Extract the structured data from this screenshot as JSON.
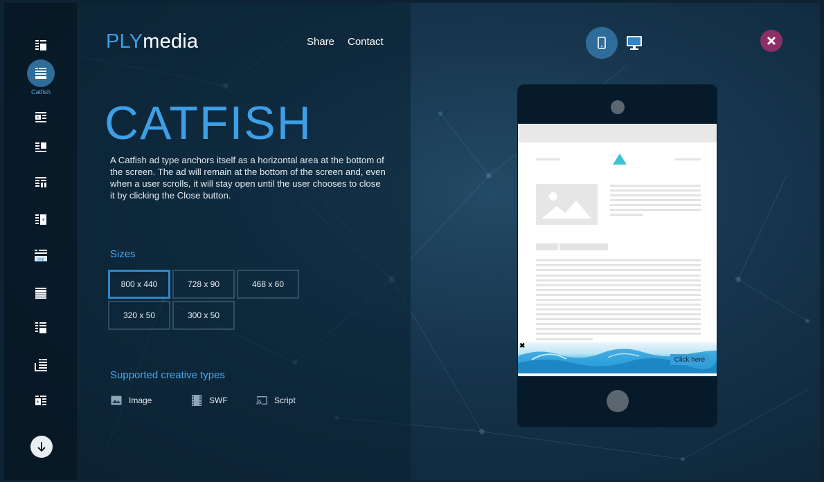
{
  "brand": {
    "part1": "PLY",
    "part2": "media"
  },
  "nav": {
    "share": "Share",
    "contact": "Contact"
  },
  "sidebar": {
    "active_caption": "Catfish",
    "items": [
      {
        "icon": "list-block-icon"
      },
      {
        "icon": "catfish-icon"
      },
      {
        "icon": "inline-video-icon"
      },
      {
        "icon": "side-block-icon"
      },
      {
        "icon": "mid-list-icon"
      },
      {
        "icon": "side-expand-icon"
      },
      {
        "icon": "skip-icon",
        "label": "skip"
      },
      {
        "icon": "full-list-icon"
      },
      {
        "icon": "bottom-block-icon"
      },
      {
        "icon": "corner-list-icon"
      },
      {
        "icon": "video-list-icon"
      }
    ]
  },
  "page": {
    "title": "CATFISH",
    "description": "A Catfish ad type anchors itself as a horizontal area at the bottom of the screen. The ad will remain at the bottom of the screen and, even when a user scrolls, it will stay open until the user chooses to close it by clicking the Close button."
  },
  "sizes": {
    "heading": "Sizes",
    "options": [
      "800 x 440",
      "728 x 90",
      "468 x 60",
      "320 x 50",
      "300 x 50"
    ],
    "selected": "800 x 440"
  },
  "creative_types": {
    "heading": "Supported creative types",
    "items": [
      {
        "label": "Image",
        "icon": "image-icon"
      },
      {
        "label": "SWF",
        "icon": "film-icon"
      },
      {
        "label": "Script",
        "icon": "cast-icon"
      }
    ]
  },
  "preview": {
    "devices": [
      "tablet",
      "desktop"
    ],
    "selected_device": "tablet",
    "ad_close": "✖",
    "ad_cta": "Click here"
  },
  "colors": {
    "accent": "#3e9fe6",
    "close": "#8c2f66",
    "highlight_triangle": "#3bc4d6"
  }
}
